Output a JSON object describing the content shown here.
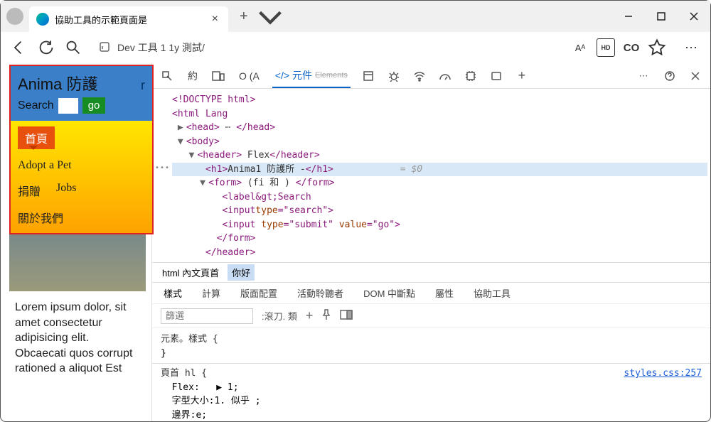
{
  "window": {
    "tab_title": "協助工具的示範頁面是",
    "url": "Dev 工具 1 1y 測試/",
    "addr_badge_hd": "HD",
    "addr_badge_co": "CO",
    "addr_read_aloud": "Aᴬ"
  },
  "page": {
    "h1": "Anima 防護",
    "h1_suffix": "r",
    "search_label": "Search",
    "go_label": "go",
    "nav": {
      "home": "首頁",
      "adopt": "Adopt a Pet",
      "donate": "捐贈",
      "jobs": "Jobs",
      "about": "關於我們"
    },
    "lorem": "Lorem ipsum dolor, sit amet consectetur adipisicing elit. Obcaecati quos corrupt rationed a aliquot Est"
  },
  "devtools": {
    "tabs": {
      "welcome": "約",
      "console_short": "O (A",
      "elements": "元件",
      "elements_sub": "Elements"
    },
    "dom": {
      "l1": "<!DOCTYPE html>",
      "l2": "<html Lang",
      "l3_open": "<head>",
      "l3_ell": "⋯",
      "l3_close": "</head>",
      "l4_open": "<body>",
      "l5_open": "<header>",
      "l5_text": " Flex",
      "l5_close": "</header>",
      "l6_open": "<h1>",
      "l6_text": "Anima1 防護所 -",
      "l6_close": "</h1>",
      "l6_hint": "= $0",
      "l7_open": "<form>",
      "l7_text": " (fi 和 ) ",
      "l7_close": "</form>",
      "l8": "<label&gt;Search",
      "l9a": "<input",
      "l9b": "type",
      "l9c": "=\"search\">",
      "l10a": "<input ",
      "l10b": "type",
      "l10c": "=\"submit\" ",
      "l10d": "value",
      "l10e": "=\"go\">",
      "l11": "</form>",
      "l12": "</header>"
    },
    "breadcrumb": {
      "b1": "html 內文頁首",
      "b2": "你好"
    },
    "style_tabs": {
      "styles": "樣式",
      "computed": "計算",
      "layout": "版面配置",
      "listeners": "活動聆聽者",
      "dom_bp": "DOM 中斷點",
      "props": "屬性",
      "a11y": "協助工具"
    },
    "filter": {
      "placeholder": "篩選",
      "hov": ":滾刀. 類"
    },
    "styles_pane": {
      "r1_sel": "元素。樣式 {",
      "r1_close": "}",
      "r2_sel": "頁首 hl {",
      "r2_link": "styles.css:257",
      "p1": "Flex:",
      "p1v": "▶ 1;",
      "p2": "字型大小:",
      "p2v": "1. 似乎    ;",
      "p3": "邊界:",
      "p3v": "e;"
    }
  }
}
